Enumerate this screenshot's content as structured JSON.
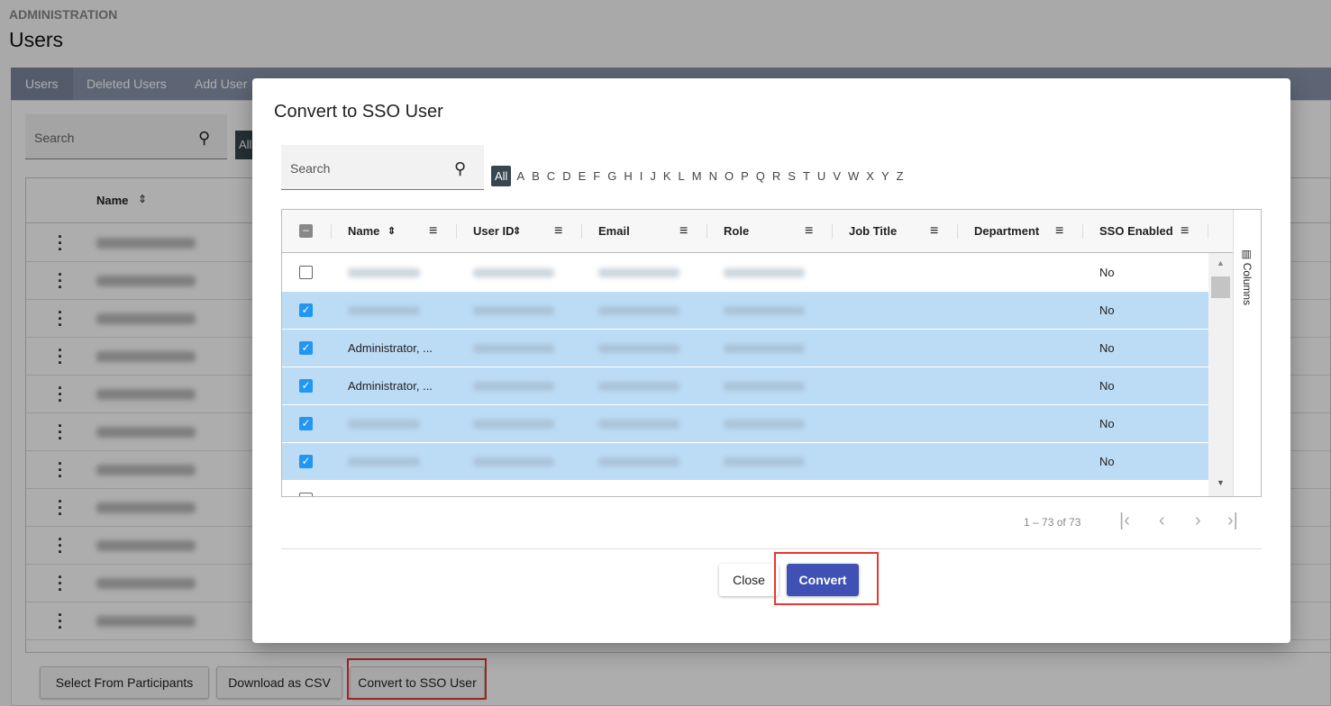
{
  "page": {
    "breadcrumb": "ADMINISTRATION",
    "title": "Users",
    "tabs": [
      {
        "label": "Users"
      },
      {
        "label": "Deleted Users"
      },
      {
        "label": "Add User"
      }
    ],
    "search_placeholder": "Search",
    "all_label": "All",
    "name_header": "Name",
    "buttons": {
      "select": "Select From Participants",
      "csv": "Download as CSV",
      "convert_sso": "Convert to SSO User"
    }
  },
  "modal": {
    "title": "Convert to SSO User",
    "search_placeholder": "Search",
    "letters": [
      "All",
      "A",
      "B",
      "C",
      "D",
      "E",
      "F",
      "G",
      "H",
      "I",
      "J",
      "K",
      "L",
      "M",
      "N",
      "O",
      "P",
      "Q",
      "R",
      "S",
      "T",
      "U",
      "V",
      "W",
      "X",
      "Y",
      "Z"
    ],
    "columns": [
      "Name",
      "User ID",
      "Email",
      "Role",
      "Job Title",
      "Department",
      "SSO Enabled"
    ],
    "columns_panel": "Columns",
    "rows": [
      {
        "checked": false,
        "name": "",
        "sso": "No"
      },
      {
        "checked": true,
        "name": "",
        "sso": "No"
      },
      {
        "checked": true,
        "name": "Administrator, ...",
        "sso": "No"
      },
      {
        "checked": true,
        "name": "Administrator, ...",
        "sso": "No"
      },
      {
        "checked": true,
        "name": "",
        "sso": "No"
      },
      {
        "checked": true,
        "name": "",
        "sso": "No"
      }
    ],
    "pager": "1 – 73 of 73",
    "close_label": "Close",
    "convert_label": "Convert"
  },
  "colors": {
    "accent": "#3f51b5",
    "selected_row": "#bcdcf5",
    "highlight": "#e53935"
  }
}
